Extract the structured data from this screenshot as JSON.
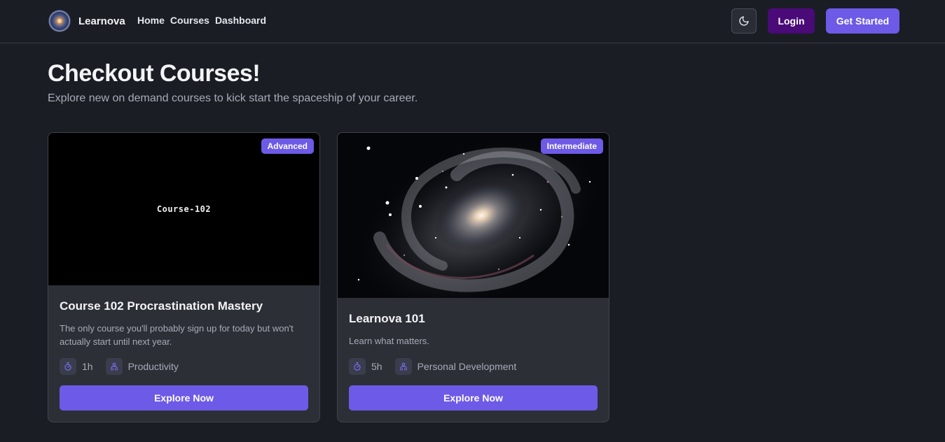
{
  "nav": {
    "brand": "Learnova",
    "links": [
      "Home",
      "Courses",
      "Dashboard"
    ],
    "theme_icon": "moon-icon",
    "login_label": "Login",
    "get_started_label": "Get Started"
  },
  "header": {
    "title": "Checkout Courses!",
    "subtitle": "Explore new on demand courses to kick start the spaceship of your career."
  },
  "courses": [
    {
      "thumbnail_text": "Course-102",
      "level": "Advanced",
      "title": "Course 102 Procrastination Mastery",
      "description": "The only course you'll probably sign up for today but won't actually start until next year.",
      "duration": "1h",
      "category": "Productivity",
      "button_label": "Explore Now"
    },
    {
      "thumbnail_text": "",
      "level": "Intermediate",
      "title": "Learnova 101",
      "description": "Learn what matters.",
      "duration": "5h",
      "category": "Personal Development",
      "button_label": "Explore Now"
    }
  ],
  "colors": {
    "background": "#1b1d25",
    "card": "#2c2f36",
    "accent": "#6d5ae6",
    "login": "#4a0a78"
  }
}
